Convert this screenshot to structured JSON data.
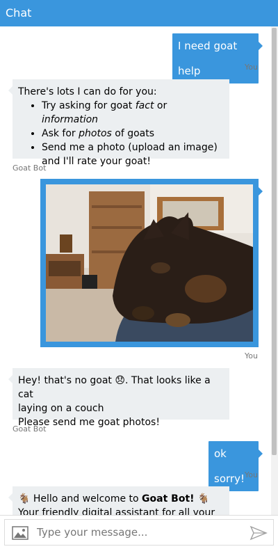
{
  "header": {
    "title": "Chat"
  },
  "messages": {
    "m1": {
      "text": "I need goat help",
      "sender": "You"
    },
    "m2": {
      "intro": "There's lots I can do for you:",
      "items": [
        {
          "prefix": "Try asking for goat ",
          "em1": "fact",
          "mid": " or ",
          "em2": "information"
        },
        {
          "prefix": "Ask for ",
          "em1": "photos",
          "suffix": " of goats"
        },
        {
          "line1": "Send me a photo (upload an image)",
          "line2": "and I'll rate your goat!"
        }
      ],
      "sender": "Goat Bot"
    },
    "m3": {
      "sender": "You"
    },
    "m4": {
      "line1_a": "Hey! that's no goat ",
      "line1_emoji": "😞",
      "line1_b": ". That looks like a cat",
      "line2": "laying on a couch",
      "line3": "Please send me goat photos!",
      "sender": "Goat Bot"
    },
    "m5": {
      "text": "ok sorry!",
      "sender": "You"
    },
    "m6": {
      "emoji_left": "🐐",
      "pre": "Hello and welcome to ",
      "bold": "Goat Bot!",
      "emoji_right": "🐐",
      "line2": "Your friendly digital assistant for all your"
    }
  },
  "input": {
    "placeholder": "Type your message..."
  },
  "icons": {
    "attach": "image-icon",
    "send": "send-icon"
  },
  "colors": {
    "accent": "#3a96dd",
    "bot_bubble": "#eceff1"
  }
}
